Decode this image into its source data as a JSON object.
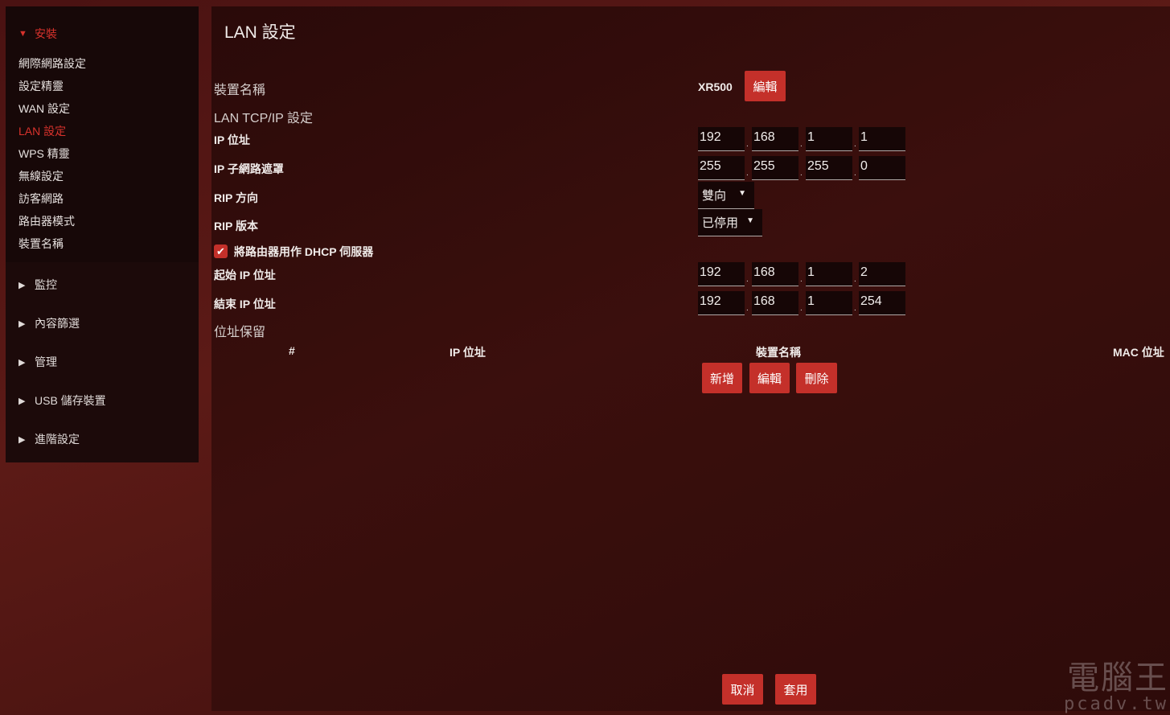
{
  "sidebar": {
    "install": {
      "arrow": "▼",
      "label": "安裝"
    },
    "items": [
      "網際網路設定",
      "設定精靈",
      "WAN 設定",
      "LAN 設定",
      "WPS 精靈",
      "無線設定",
      "訪客網路",
      "路由器模式",
      "裝置名稱"
    ],
    "active_item": "LAN 設定",
    "sections": [
      {
        "arrow": "▶",
        "label": "監控"
      },
      {
        "arrow": "▶",
        "label": "內容篩選"
      },
      {
        "arrow": "▶",
        "label": "管理"
      },
      {
        "arrow": "▶",
        "label": "USB 儲存裝置"
      },
      {
        "arrow": "▶",
        "label": "進階設定"
      }
    ]
  },
  "main": {
    "title": "LAN 設定",
    "device_name": {
      "label": "裝置名稱",
      "value": "XR500",
      "edit_button": "編輯"
    },
    "lan_tcpip_heading": "LAN TCP/IP 設定",
    "ip_address": {
      "label": "IP 位址",
      "octets": [
        "192",
        "168",
        "1",
        "1"
      ]
    },
    "subnet_mask": {
      "label": "IP 子網路遮罩",
      "octets": [
        "255",
        "255",
        "255",
        "0"
      ]
    },
    "rip_direction": {
      "label": "RIP 方向",
      "value": "雙向"
    },
    "rip_version": {
      "label": "RIP 版本",
      "value": "已停用"
    },
    "dhcp": {
      "checked": true,
      "label": "將路由器用作 DHCP 伺服器"
    },
    "start_ip": {
      "label": "起始 IP 位址",
      "octets": [
        "192",
        "168",
        "1",
        "2"
      ]
    },
    "end_ip": {
      "label": "結束 IP 位址",
      "octets": [
        "192",
        "168",
        "1",
        "254"
      ]
    },
    "reservation": {
      "heading": "位址保留",
      "columns": [
        "#",
        "IP 位址",
        "裝置名稱",
        "MAC 位址"
      ],
      "buttons": {
        "add": "新增",
        "edit": "編輯",
        "delete": "刪除"
      }
    },
    "footer": {
      "cancel": "取消",
      "apply": "套用"
    }
  },
  "watermark": {
    "main": "電腦王",
    "sub": "pcadv.tw"
  },
  "colors": {
    "accent": "#c4302a",
    "active_text": "#d8322c"
  }
}
